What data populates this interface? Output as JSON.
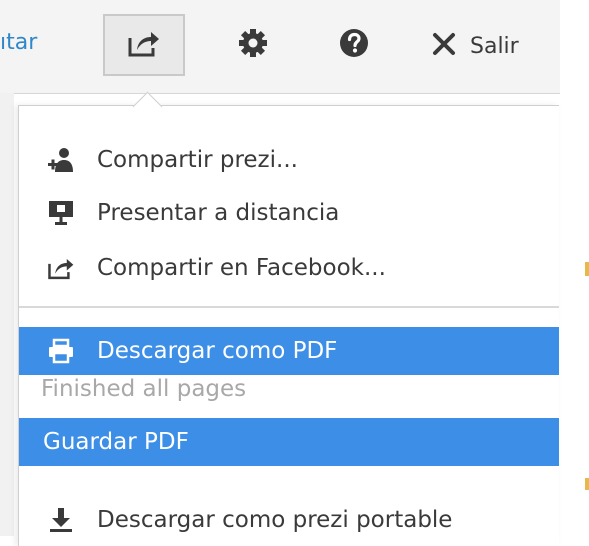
{
  "toolbar": {
    "edit_partial": "ıtar",
    "exit_label": "Salir"
  },
  "menu": {
    "items": [
      {
        "label": "Compartir prezi...",
        "icon": "add-user-icon"
      },
      {
        "label": "Presentar a distancia",
        "icon": "presentation-screen-icon"
      },
      {
        "label": "Compartir en Facebook...",
        "icon": "share-icon"
      },
      {
        "label": "Descargar como PDF",
        "icon": "printer-icon"
      },
      {
        "label": "Descargar como prezi portable",
        "icon": "download-icon"
      }
    ],
    "status_text": "Finished all pages",
    "save_pdf_label": "Guardar PDF"
  },
  "colors": {
    "highlight": "#3d8ee6",
    "link": "#2f86c9",
    "icon": "#3a3a3a",
    "status": "#a8a8a8"
  }
}
